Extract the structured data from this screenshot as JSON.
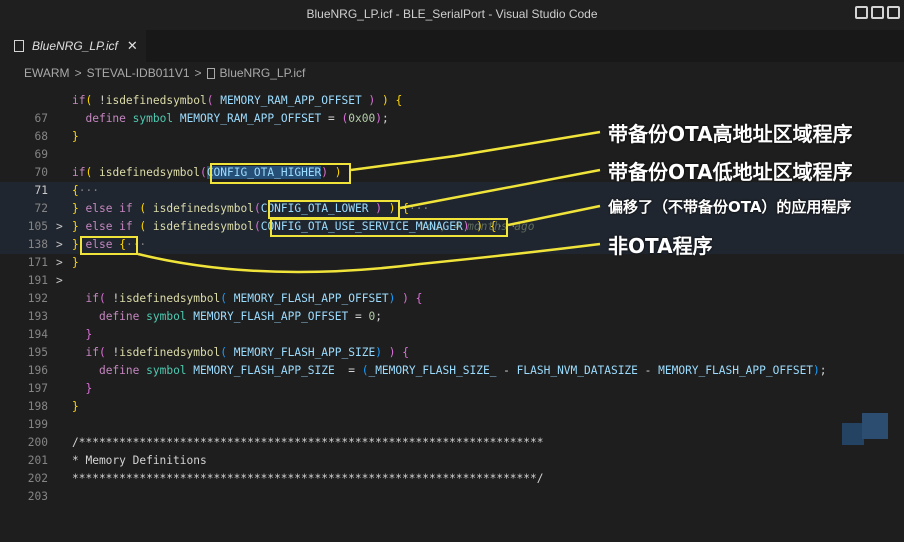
{
  "window": {
    "title": "BlueNRG_LP.icf - BLE_SerialPort - Visual Studio Code"
  },
  "tab": {
    "label": "BlueNRG_LP.icf",
    "close": "✕"
  },
  "breadcrumb": {
    "items": [
      "EWARM",
      "STEVAL-IDB011V1",
      "BlueNRG_LP.icf"
    ],
    "sep": ">"
  },
  "editor": {
    "lines": [
      {
        "n": "67"
      },
      {
        "n": "68"
      },
      {
        "n": "69"
      },
      {
        "n": "70"
      },
      {
        "n": "71"
      },
      {
        "n": "72"
      },
      {
        "n": "105"
      },
      {
        "n": "138"
      },
      {
        "n": "171"
      },
      {
        "n": "191"
      },
      {
        "n": "192"
      },
      {
        "n": "193"
      },
      {
        "n": "194"
      },
      {
        "n": "195"
      },
      {
        "n": "196"
      },
      {
        "n": "197"
      },
      {
        "n": "198"
      },
      {
        "n": "199"
      },
      {
        "n": "200"
      },
      {
        "n": "201"
      },
      {
        "n": "202"
      },
      {
        "n": "203"
      }
    ],
    "blame": "You, 4 months ago"
  },
  "annotations": {
    "ota_high": "带备份OTA高地址区域程序",
    "ota_low": "带备份OTA低地址区域程序",
    "service_manager": "偏移了（不带备份OTA）的应用程序",
    "non_ota": "非OTA程序"
  },
  "colors": {
    "annotation_line": "#f0e33a",
    "editor_bg": "#1e1e1e"
  }
}
